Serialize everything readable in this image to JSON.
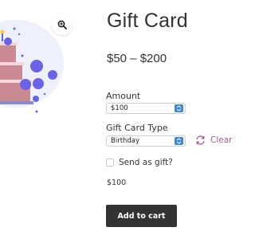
{
  "product": {
    "title": "Gift Card",
    "price_range": "$50 – $200"
  },
  "gallery": {
    "image_icon": "birthday-cake-with-balloons",
    "zoom_icon": "magnifier-plus-icon"
  },
  "fields": {
    "amount_label": "Amount",
    "amount_value": "$100",
    "type_label": "Gift Card Type",
    "type_value": "Birthday",
    "clear_label": "Clear",
    "gift_label": "Send as gift?"
  },
  "summary": {
    "total": "$100"
  },
  "actions": {
    "add_to_cart_label": "Add to cart"
  },
  "colors": {
    "button_bg": "#333333",
    "clear_link": "#9b5c8f",
    "select_stepper": "#3f86d8",
    "balloon": "#6b63e6",
    "cake": "#c98a93"
  }
}
